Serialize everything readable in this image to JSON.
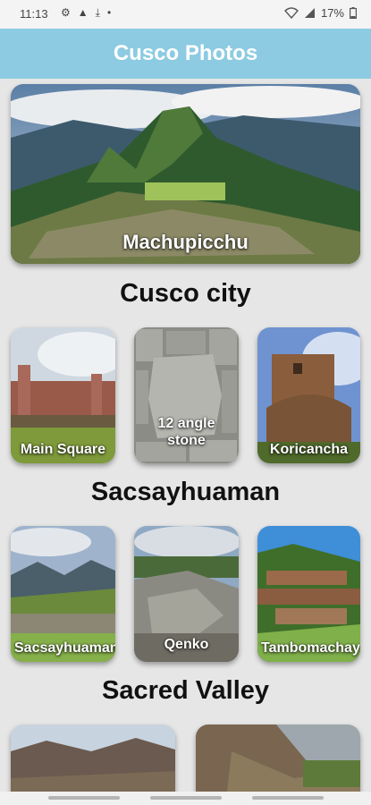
{
  "status_bar": {
    "time": "11:13",
    "battery": "17%",
    "icons": [
      "settings-dot-icon",
      "warning-icon",
      "download-icon",
      "dot-icon",
      "wifi-icon",
      "signal-icon",
      "battery-icon"
    ]
  },
  "app_bar": {
    "title": "Cusco Photos"
  },
  "hero": {
    "label": "Machupicchu"
  },
  "sections": [
    {
      "title": "Cusco city",
      "items": [
        {
          "label": "Main Square"
        },
        {
          "label": "12 angle stone"
        },
        {
          "label": "Koricancha"
        }
      ]
    },
    {
      "title": "Sacsayhuaman",
      "items": [
        {
          "label": "Sacsayhuaman"
        },
        {
          "label": "Qenko"
        },
        {
          "label": "Tambomachay"
        }
      ]
    },
    {
      "title": "Sacred Valley",
      "items": [
        {
          "label": ""
        },
        {
          "label": ""
        }
      ]
    }
  ],
  "colors": {
    "app_bar": "#8ccbe2",
    "background": "#e6e6e6",
    "title_text": "#ffffff"
  }
}
